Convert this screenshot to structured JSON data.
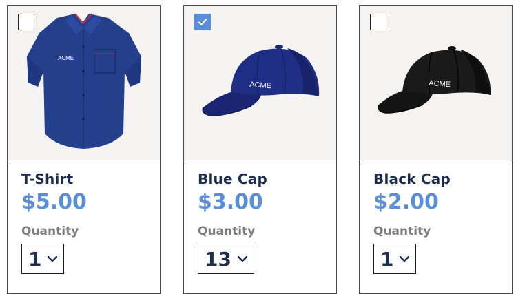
{
  "products": [
    {
      "name": "T-Shirt",
      "price": "$5.00",
      "quantity_label": "Quantity",
      "quantity": "1",
      "selected": false,
      "logo_text": "ACME",
      "image_icon": "shirt-image"
    },
    {
      "name": "Blue Cap",
      "price": "$3.00",
      "quantity_label": "Quantity",
      "quantity": "13",
      "selected": true,
      "logo_text": "ACME",
      "image_icon": "blue-cap-image"
    },
    {
      "name": "Black Cap",
      "price": "$2.00",
      "quantity_label": "Quantity",
      "quantity": "1",
      "selected": false,
      "logo_text": "ACME",
      "image_icon": "black-cap-image"
    }
  ],
  "colors": {
    "accent": "#5b8ed8",
    "title": "#1f2d4d",
    "label": "#7d7d7d",
    "image_bg": "#f4f3f1"
  }
}
